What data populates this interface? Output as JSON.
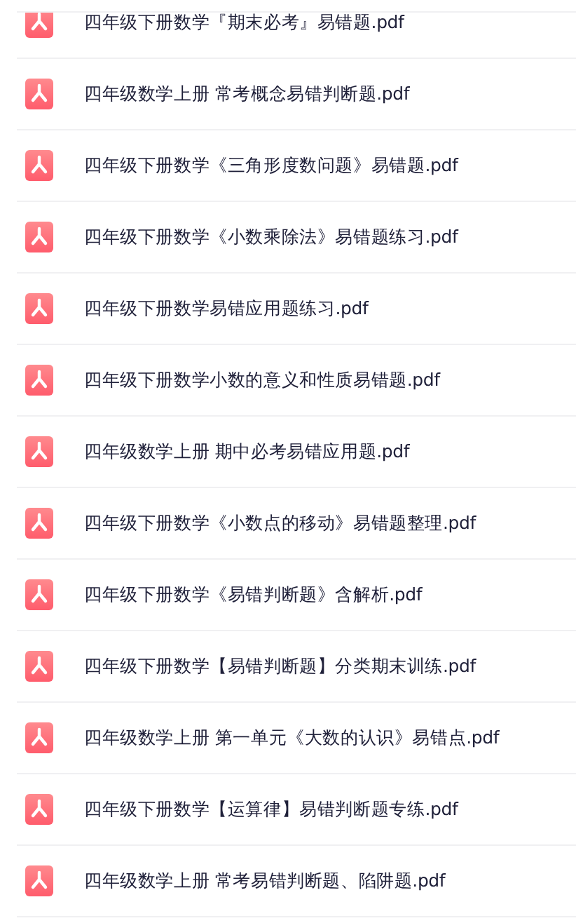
{
  "files": [
    {
      "name": "四年级下册数学『期末必考』易错题.pdf"
    },
    {
      "name": "四年级数学上册 常考概念易错判断题.pdf"
    },
    {
      "name": "四年级下册数学《三角形度数问题》易错题.pdf"
    },
    {
      "name": "四年级下册数学《小数乘除法》易错题练习.pdf"
    },
    {
      "name": "四年级下册数学易错应用题练习.pdf"
    },
    {
      "name": "四年级下册数学小数的意义和性质易错题.pdf"
    },
    {
      "name": "四年级数学上册 期中必考易错应用题.pdf"
    },
    {
      "name": "四年级下册数学《小数点的移动》易错题整理.pdf"
    },
    {
      "name": "四年级下册数学《易错判断题》含解析.pdf"
    },
    {
      "name": "四年级下册数学【易错判断题】分类期末训练.pdf"
    },
    {
      "name": "四年级数学上册 第一单元《大数的认识》易错点.pdf"
    },
    {
      "name": "四年级下册数学【运算律】易错判断题专练.pdf"
    },
    {
      "name": "四年级数学上册 常考易错判断题、陷阱题.pdf"
    }
  ]
}
